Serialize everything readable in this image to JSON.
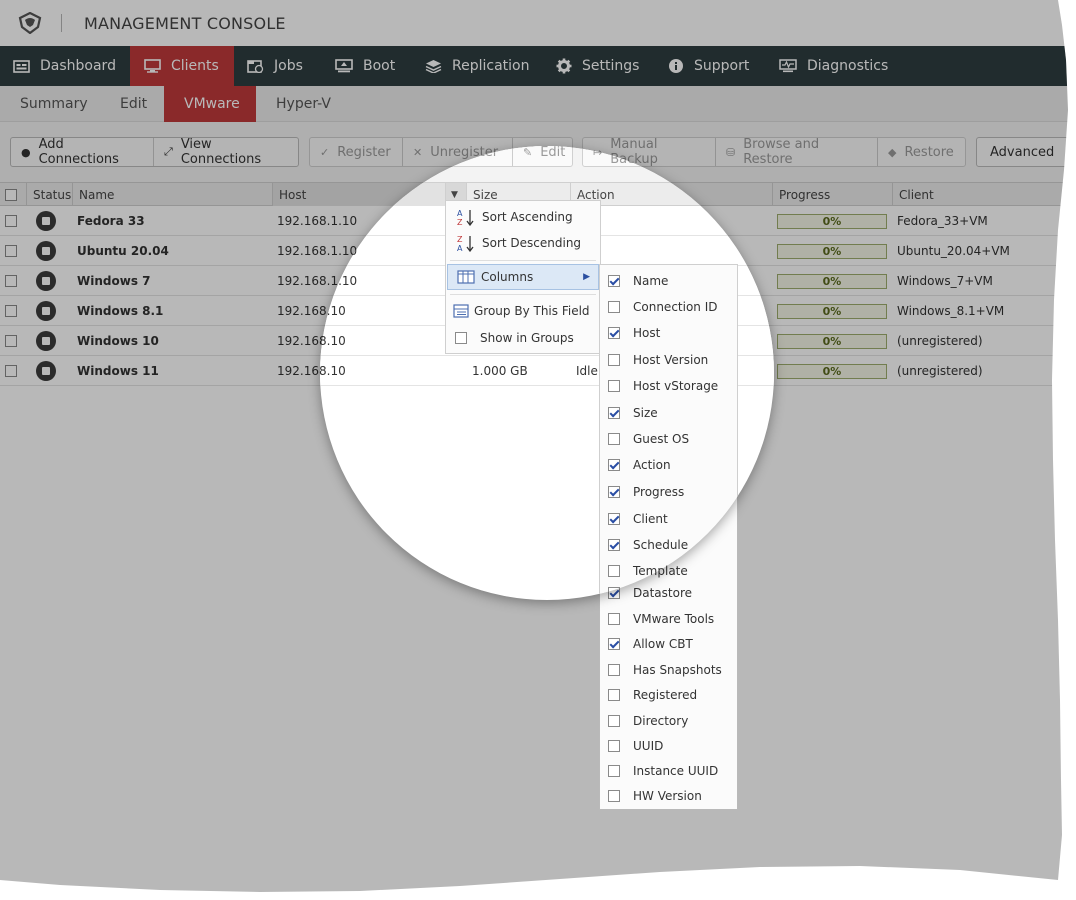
{
  "app": {
    "title": "MANAGEMENT CONSOLE"
  },
  "nav": {
    "items": [
      {
        "label": "Dashboard",
        "icon": "dashboard-icon"
      },
      {
        "label": "Clients",
        "icon": "monitor-icon",
        "active": true
      },
      {
        "label": "Jobs",
        "icon": "jobs-icon"
      },
      {
        "label": "Boot",
        "icon": "boot-icon"
      },
      {
        "label": "Replication",
        "icon": "replication-icon"
      },
      {
        "label": "Settings",
        "icon": "gear-icon"
      },
      {
        "label": "Support",
        "icon": "info-icon"
      },
      {
        "label": "Diagnostics",
        "icon": "diagnostics-icon"
      }
    ]
  },
  "subnav": {
    "items": [
      {
        "label": "Summary"
      },
      {
        "label": "Edit"
      },
      {
        "label": "VMware",
        "active": true
      },
      {
        "label": "Hyper-V"
      }
    ]
  },
  "toolbar": {
    "add_connections": "Add Connections",
    "view_connections": "View Connections",
    "register": "Register",
    "unregister": "Unregister",
    "edit": "Edit",
    "manual_backup": "Manual Backup",
    "browse_restore": "Browse and Restore",
    "restore": "Restore",
    "advanced": "Advanced"
  },
  "grid": {
    "headers": {
      "status": "Status",
      "name": "Name",
      "host": "Host",
      "size": "Size",
      "action": "Action",
      "progress": "Progress",
      "client": "Client"
    },
    "rows": [
      {
        "name": "Fedora 33",
        "host": "192.168.1.10",
        "size": "",
        "action": "",
        "progress": "0%",
        "client": "Fedora_33+VM"
      },
      {
        "name": "Ubuntu 20.04",
        "host": "192.168.1.10",
        "size": "",
        "action": "",
        "progress": "0%",
        "client": "Ubuntu_20.04+VM"
      },
      {
        "name": "Windows 7",
        "host": "192.168.1.10",
        "size": "",
        "action": "",
        "progress": "0%",
        "client": "Windows_7+VM"
      },
      {
        "name": "Windows 8.1",
        "host": "192.168.10",
        "size": "",
        "action": "",
        "progress": "0%",
        "client": "Windows_8.1+VM"
      },
      {
        "name": "Windows 10",
        "host": "192.168.10",
        "size": "",
        "action": "",
        "progress": "0%",
        "client": "(unregistered)"
      },
      {
        "name": "Windows 11",
        "host": "192.168.10",
        "size": "1.000 GB",
        "action": "Idle",
        "progress": "0%",
        "client": "(unregistered)"
      }
    ]
  },
  "context_menu": {
    "sort_asc": "Sort Ascending",
    "sort_desc": "Sort Descending",
    "columns": "Columns",
    "group_by": "Group By This Field",
    "show_in_groups": "Show in Groups"
  },
  "columns_menu": [
    {
      "label": "Name",
      "checked": true
    },
    {
      "label": "Connection ID",
      "checked": false
    },
    {
      "label": "Host",
      "checked": true
    },
    {
      "label": "Host Version",
      "checked": false
    },
    {
      "label": "Host vStorage",
      "checked": false
    },
    {
      "label": "Size",
      "checked": true
    },
    {
      "label": "Guest OS",
      "checked": false
    },
    {
      "label": "Action",
      "checked": true
    },
    {
      "label": "Progress",
      "checked": true
    },
    {
      "label": "Client",
      "checked": true
    },
    {
      "label": "Schedule",
      "checked": true
    },
    {
      "label": "Template",
      "checked": false
    },
    {
      "label": "Datastore",
      "checked": true
    },
    {
      "label": "VMware Tools",
      "checked": false
    },
    {
      "label": "Allow CBT",
      "checked": true
    },
    {
      "label": "Has Snapshots",
      "checked": false
    },
    {
      "label": "Registered",
      "checked": false
    },
    {
      "label": "Directory",
      "checked": false
    },
    {
      "label": "UUID",
      "checked": false
    },
    {
      "label": "Instance UUID",
      "checked": false
    },
    {
      "label": "HW Version",
      "checked": false
    }
  ],
  "colors": {
    "accent": "#c0393b",
    "nav_bg": "#2f3e40"
  }
}
